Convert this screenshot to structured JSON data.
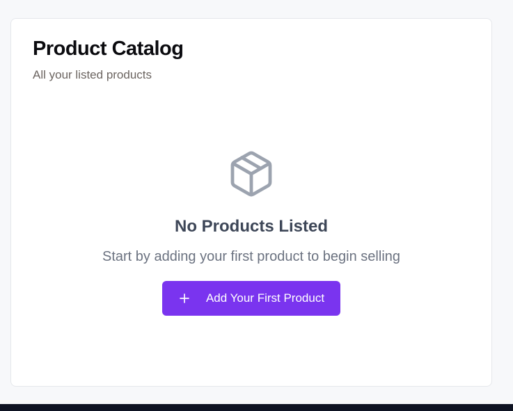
{
  "catalog": {
    "title": "Product Catalog",
    "subtitle": "All your listed products"
  },
  "empty_state": {
    "icon": "package-icon",
    "title": "No Products Listed",
    "description": "Start by adding your first product to begin selling",
    "button_icon": "plus-icon",
    "button_label": "Add Your First Product"
  },
  "colors": {
    "accent": "#7a34ef",
    "icon_gray": "#9ca3af",
    "page_background": "#f7f8fa",
    "footer_bar": "#0e1322"
  }
}
